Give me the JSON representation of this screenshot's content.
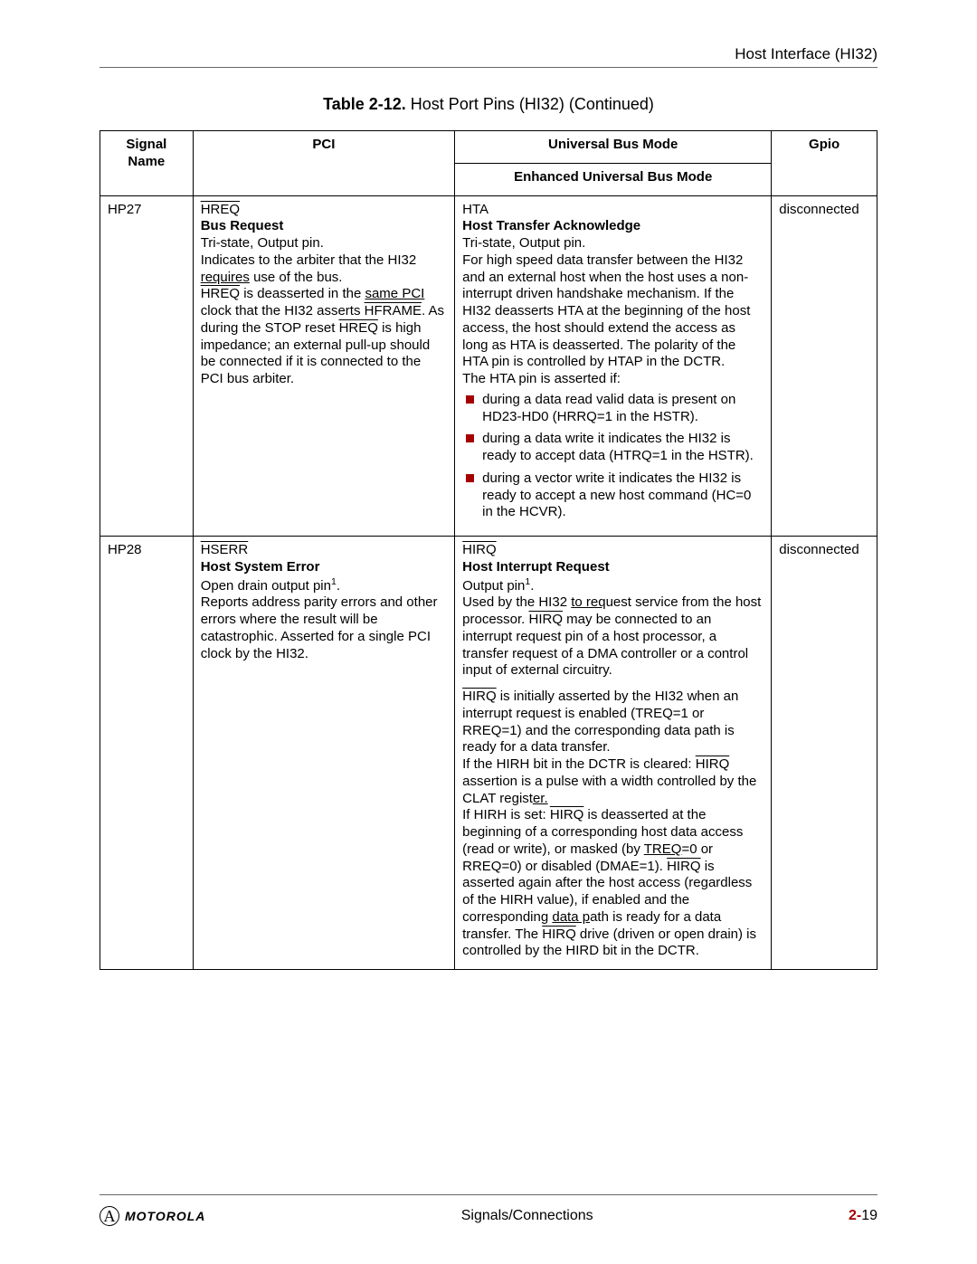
{
  "header": {
    "right": "Host Interface (HI32)"
  },
  "caption": {
    "bold": "Table 2-12.",
    "rest": " Host Port Pins (HI32) (Continued)"
  },
  "thead": {
    "signal": "Signal Name",
    "pci": "PCI",
    "ubm": "Universal Bus Mode",
    "eubm": "Enhanced Universal Bus Mode",
    "gpio": "Gpio"
  },
  "rows": [
    {
      "signal": "HP27",
      "pci": {
        "sig": "HREQ",
        "title": "Bus Request",
        "p1": "Tri-state, Output pin.",
        "p2a": "Indicates to the arbiter that the HI32 ",
        "p2b": "requires",
        "p2c": " use of the bus.",
        "p3a": "HREQ",
        "p3b": " is deasserted in the ",
        "p3c": "same PCI",
        "p3d": " clock that the HI32 asserts ",
        "p3e": "HFRAME",
        "p3f": ". As during the STOP reset ",
        "p3g": "HREQ",
        "p3h": " is high impedance; an external pull-up should be connected if it is connected to the PCI bus arbiter."
      },
      "ubm": {
        "sig": "HTA",
        "title": "Host Transfer Acknowledge",
        "p1": "Tri-state, Output pin.",
        "p2": "For high speed data transfer between the HI32 and an external host when the host uses a non-interrupt driven handshake mechanism. If the HI32 deasserts HTA at the beginning of the host access, the host should extend the access as long as HTA is deasserted. The polarity of the HTA pin is controlled by HTAP in the DCTR.",
        "p3": "The HTA pin is asserted if:",
        "b1": "during a data read valid data is present on HD23-HD0 (HRRQ=1 in the HSTR).",
        "b2": "during a data write it indicates the HI32 is ready to accept data (HTRQ=1 in the HSTR).",
        "b3": "during a vector write it indicates the HI32 is ready to accept a new host command (HC=0 in the HCVR)."
      },
      "gpio": "disconnected"
    },
    {
      "signal": "HP28",
      "pci": {
        "sig": "HSERR",
        "title": "Host System Error",
        "p1a": "Open drain output pin",
        "sup": "1",
        "p1b": ".",
        "p2": "Reports address parity errors and other errors where the result will be catastrophic. Asserted for a single PCI clock by the HI32."
      },
      "ubm": {
        "sig": "HIRQ",
        "title": "Host Interrupt Request",
        "p1a": "Output pin",
        "sup": "1",
        "p1b": ".",
        "p2a": "Used by the HI32 ",
        "p2b": "to req",
        "p2c": "uest service from the host processor. ",
        "p2sig1": "HIRQ",
        "p2d": " may be connected to an interrupt request pin of a host processor, a transfer request of a DMA controller or a control input of external circuitry.",
        "p3sig1": "HIRQ",
        "p3a": " is initially asserted by the HI32 when an interrupt request is enabled (TREQ=1 or RREQ=1) and the corresponding data path is ready for a data transfer.",
        "p4a": "If the HIRH bit in the DCTR is cleared: ",
        "p4sig": "HIRQ",
        "p4b": " assertion is a pulse with a width controlled by the CLAT regist",
        "p4c": "er.",
        "p5a": "If HIRH is set: ",
        "p5sig": "HIRQ",
        "p5b": " is deasserted at the beginning of a corresponding host data access (read or write), or masked (by ",
        "p5c": "TREQ",
        "p5d": "=0 or RREQ=0) or disabled (DMAE=1). ",
        "p5sig2": "HIRQ",
        "p5e": " is asserted again after the host access (regardless of the HIRH value), if enabled and the corresponding ",
        "p5f": "data p",
        "p5g": "ath is ready for a data transfer. The ",
        "p5sig3": "HIRQ",
        "p5h": " drive (driven or open drain) is controlled by the HIRD bit in the DCTR."
      },
      "gpio": "disconnected"
    }
  ],
  "footer": {
    "brand": "MOTOROLA",
    "center": "Signals/Connections",
    "page_prefix": "2-",
    "page_num": "19",
    "logo_glyph": "A"
  }
}
